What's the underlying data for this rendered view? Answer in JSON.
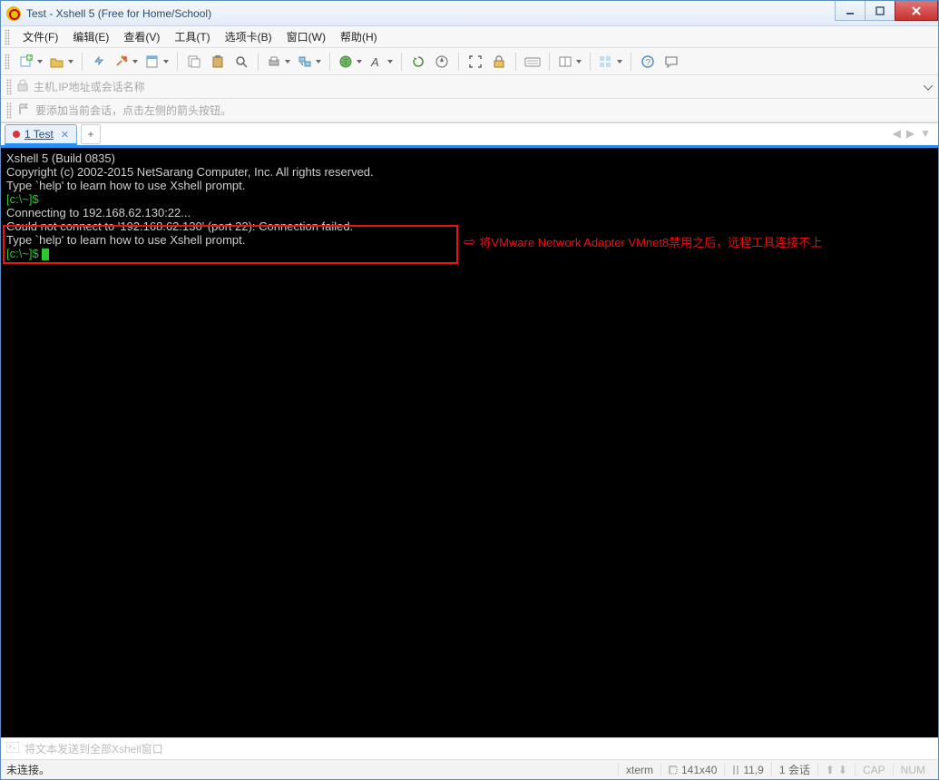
{
  "window": {
    "title": "Test - Xshell 5 (Free for Home/School)"
  },
  "menus": {
    "file": "文件(F)",
    "edit": "编辑(E)",
    "view": "查看(V)",
    "tools": "工具(T)",
    "tabs": "选项卡(B)",
    "window": "窗口(W)",
    "help": "帮助(H)"
  },
  "address": {
    "placeholder": "主机,IP地址或会话名称"
  },
  "hint": {
    "text": "要添加当前会话，点击左侧的箭头按钮。"
  },
  "tab": {
    "name": "1 Test"
  },
  "terminal": {
    "l1": "Xshell 5 (Build 0835)",
    "l2": "Copyright (c) 2002-2015 NetSarang Computer, Inc. All rights reserved.",
    "l3": "",
    "l4": "Type `help' to learn how to use Xshell prompt.",
    "p1": "[c:\\~]$ ",
    "l6": "",
    "l7": "Connecting to 192.168.62.130:22...",
    "l8": "Could not connect to '192.168.62.130' (port 22): Connection failed.",
    "l9": "",
    "l10": "Type `help' to learn how to use Xshell prompt.",
    "p2": "[c:\\~]$ "
  },
  "annotation": {
    "text": "将VMware Network Adapter VMnet8禁用之后，远程工具连接不上"
  },
  "send": {
    "placeholder": "将文本发送到全部Xshell窗口"
  },
  "status": {
    "left": "未连接。",
    "term": "xterm",
    "size": "141x40",
    "pos": "11,9",
    "sess": "1 会话",
    "cap": "CAP",
    "num": "NUM"
  }
}
